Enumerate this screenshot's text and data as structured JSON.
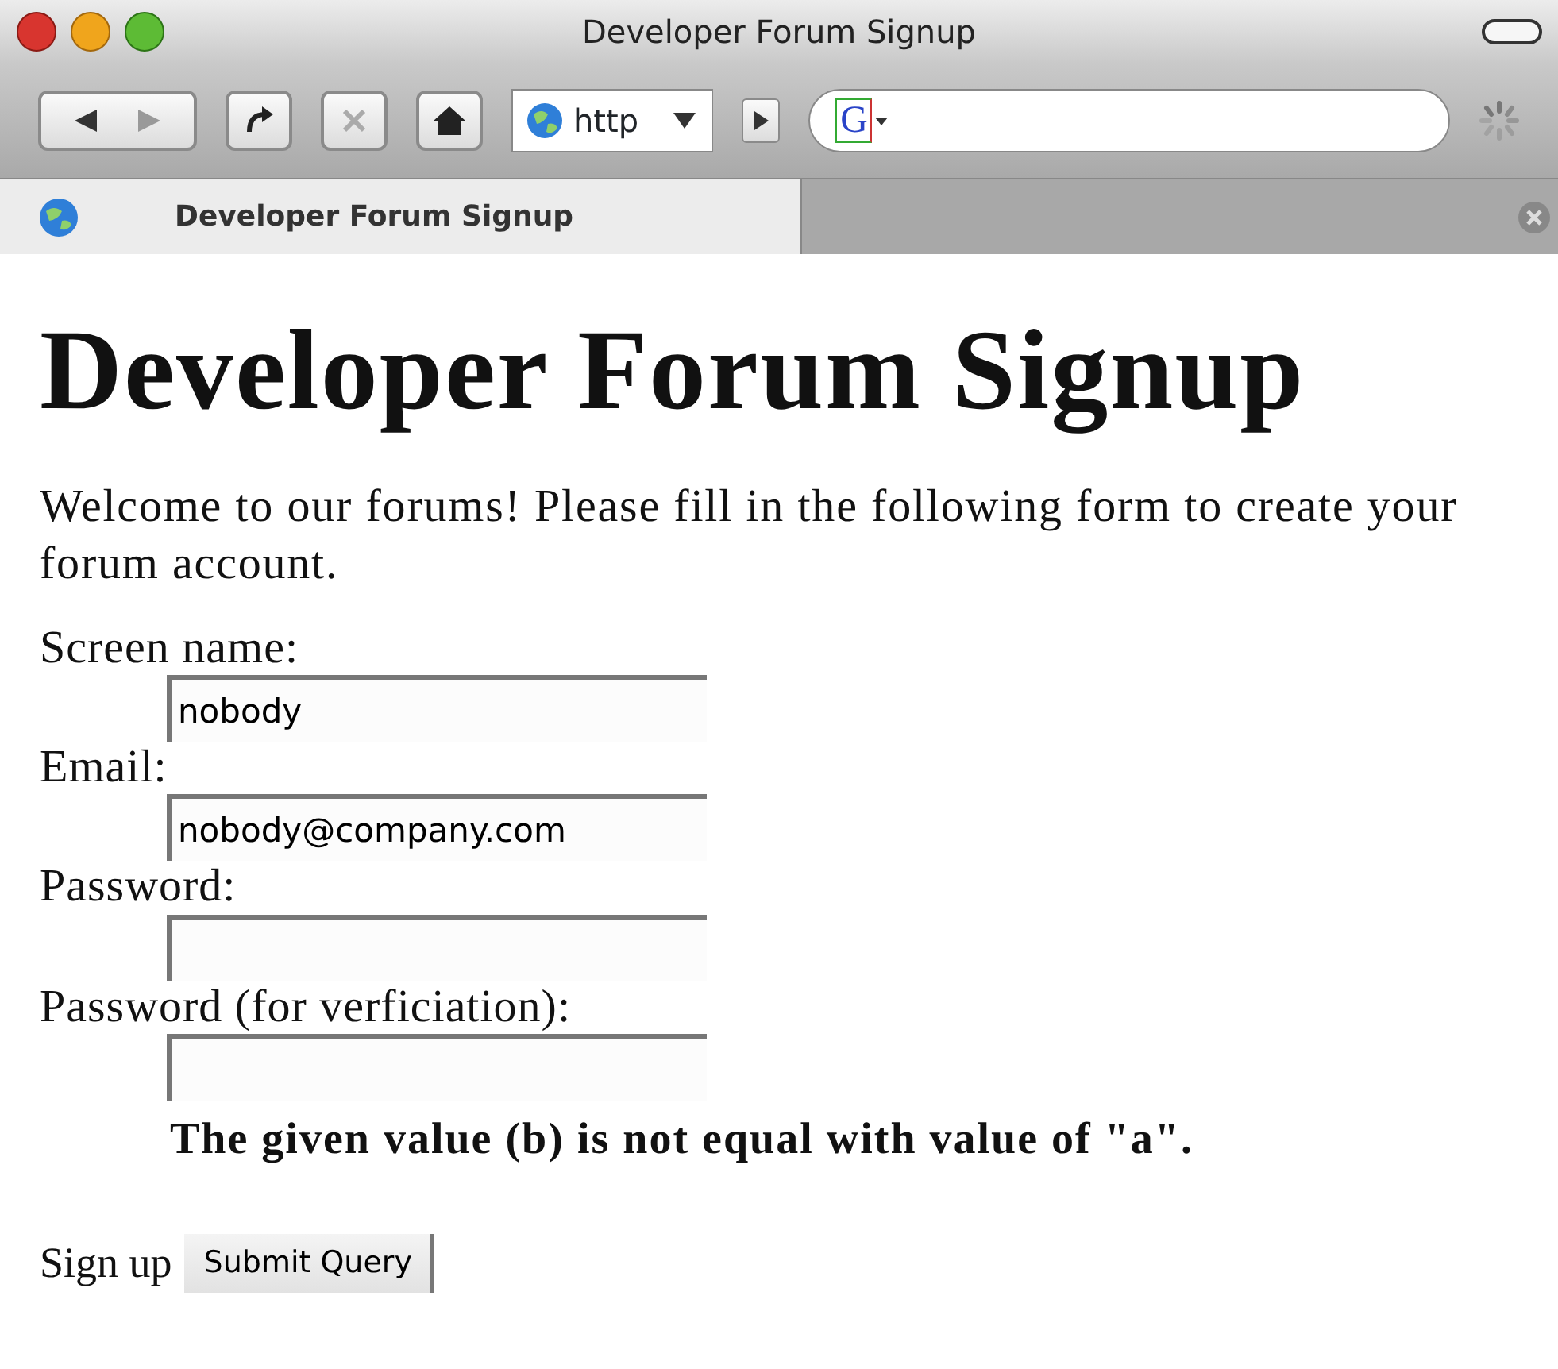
{
  "window": {
    "title": "Developer Forum Signup"
  },
  "toolbar": {
    "address": {
      "scheme": "http"
    },
    "search": {
      "engine_letter": "G"
    },
    "stop_disabled": true
  },
  "tabs": [
    {
      "label": "Developer Forum Signup",
      "selected": true
    }
  ],
  "page": {
    "heading": "Developer Forum Signup",
    "intro": "Welcome to our forums! Please fill in the following form to create your forum account.",
    "fields": [
      {
        "label": "Screen name:",
        "value": "nobody"
      },
      {
        "label": "Email:",
        "value": "nobody@company.com"
      },
      {
        "label": "Password:"
      },
      {
        "label": "Password (for verficiation):",
        "error": "The given value (b) is not equal with value of \"a\"."
      }
    ],
    "submit": {
      "label": "Sign up",
      "button": "Submit Query"
    }
  }
}
